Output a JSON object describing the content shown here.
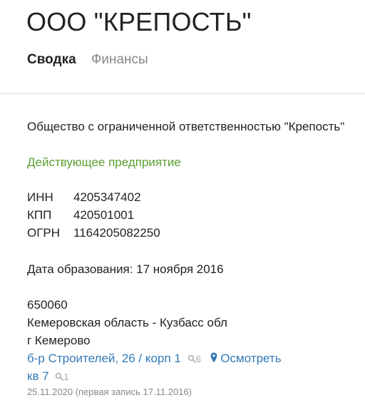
{
  "header": {
    "title": "ООО \"КРЕПОСТЬ\"",
    "tabs": [
      {
        "label": "Сводка",
        "active": true
      },
      {
        "label": "Финансы",
        "active": false
      }
    ]
  },
  "company": {
    "full_name": "Общество с ограниченной ответственностью \"Крепость\"",
    "status": "Действующее предприятие",
    "status_color": "#5a9f31",
    "codes": [
      {
        "label": "ИНН",
        "value": "4205347402"
      },
      {
        "label": "КПП",
        "value": "420501001"
      },
      {
        "label": "ОГРН",
        "value": "1164205082250"
      }
    ],
    "registration": "Дата образования: 17 ноября 2016"
  },
  "address": {
    "postal_code": "650060",
    "region": "Кемеровская область - Кузбасс обл",
    "city": "г Кемерово",
    "street_link": "б-р Строителей, 26 / корп 1",
    "street_count": "6",
    "map_link": "Осмотреть",
    "apartment_link": "кв 7",
    "apartment_count": "1",
    "icons": {
      "search": "search-icon",
      "map": "map-marker-icon"
    },
    "link_color": "#337ab7"
  },
  "updated": "25.11.2020 (первая запись 17.11.2016)"
}
